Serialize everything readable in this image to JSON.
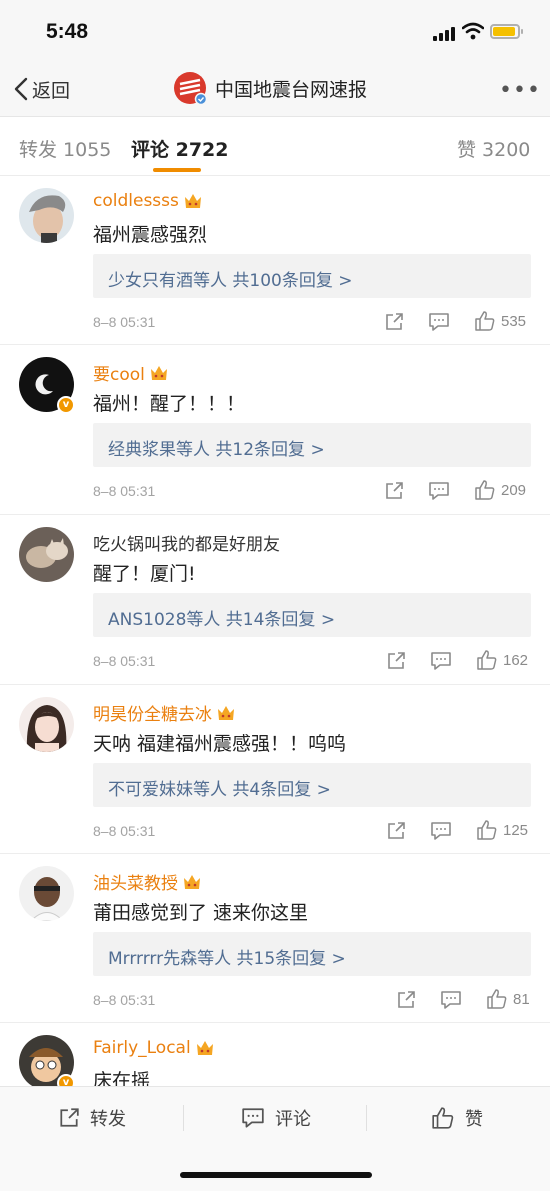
{
  "status": {
    "time": "5:48"
  },
  "nav": {
    "back_label": "返回",
    "title": "中国地震台网速报",
    "more": "•••"
  },
  "tabs": [
    {
      "label": "转发 1055"
    },
    {
      "label": "评论 2722"
    },
    {
      "label": "赞 3200"
    }
  ],
  "comments": [
    {
      "user": "coldlessss",
      "text": "福州震感强烈",
      "reply": "少女只有酒等人  共100条回复 >",
      "time": "8–8 05:31",
      "likes": "535"
    },
    {
      "user": "要cool",
      "text": "福州！醒了！！！",
      "reply": "经典浆果等人  共12条回复 >",
      "time": "8–8 05:31",
      "likes": "209"
    },
    {
      "user": "吃火锅叫我的都是好朋友",
      "text": "醒了！厦门!",
      "reply": "ANS1028等人  共14条回复 >",
      "time": "8–8 05:31",
      "likes": "162"
    },
    {
      "user": "明昊份全糖去冰",
      "text": "天呐 福建福州震感强！！呜呜",
      "reply": "不可爱妹妹等人  共4条回复 >",
      "time": "8–8 05:31",
      "likes": "125"
    },
    {
      "user": "油头菜教授",
      "text": "莆田感觉到了 速来你这里",
      "reply": "Mrrrrrr先森等人  共15条回复 >",
      "time": "8–8 05:31",
      "likes": "81"
    },
    {
      "user": "Fairly_Local",
      "text": "床在摇"
    }
  ],
  "bottom": {
    "forward": "转发",
    "comment": "评论",
    "like": "赞"
  },
  "colors": {
    "accent": "#f08c00",
    "username": "#ea8010",
    "reply_link": "#516d92",
    "verified": "#f19800"
  }
}
